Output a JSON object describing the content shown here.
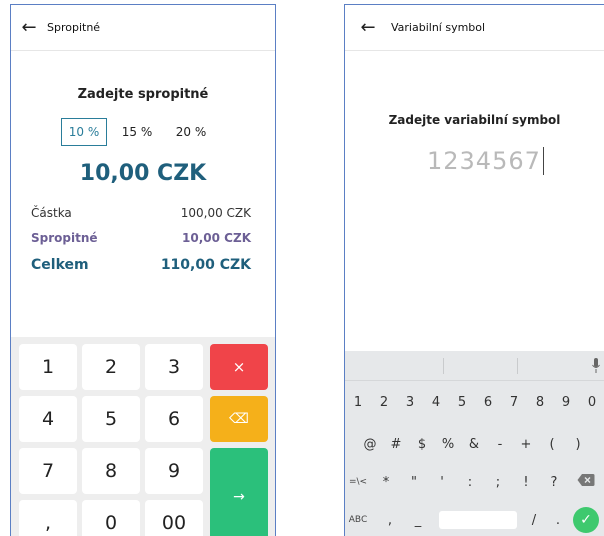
{
  "left": {
    "title": "Spropitné",
    "back_icon": "←",
    "heading": "Zadejte spropitné",
    "tip_options": [
      "10 %",
      "15 %",
      "20 %"
    ],
    "selected_tip": "10 %",
    "tip_amount": "10,00 CZK",
    "summary": {
      "amount_label": "Částka",
      "amount_value": "100,00 CZK",
      "tip_label": "Spropitné",
      "tip_value": "10,00 CZK",
      "total_label": "Celkem",
      "total_value": "110,00 CZK"
    },
    "keypad": {
      "keys": [
        "1",
        "2",
        "3",
        "4",
        "5",
        "6",
        "7",
        "8",
        "9",
        ",",
        "0",
        "00"
      ],
      "cancel": "×",
      "backspace": "⌫",
      "confirm": "→"
    },
    "colors": {
      "accent": "#1f5f7c",
      "tip": "#6c5f95",
      "cancel": "#f04449",
      "backspace": "#f5b01a",
      "confirm": "#2bc07b"
    }
  },
  "right": {
    "title": "Variabilní symbol",
    "back_icon": "←",
    "heading": "Zadejte variabilní symbol",
    "value": "1234567",
    "keyboard": {
      "row1": [
        "1",
        "2",
        "3",
        "4",
        "5",
        "6",
        "7",
        "8",
        "9",
        "0"
      ],
      "row2": [
        "@",
        "#",
        "$",
        "%",
        "&",
        "-",
        "+",
        "(",
        ")"
      ],
      "row3": [
        "=\\<",
        "*",
        "\"",
        "'",
        ":",
        ";",
        "!",
        "?"
      ],
      "row4_left": [
        "ABC",
        ",",
        "_"
      ],
      "row4_right": [
        "/",
        "."
      ],
      "enter": "✓"
    },
    "colors": {
      "enter": "#3ec96e"
    }
  }
}
